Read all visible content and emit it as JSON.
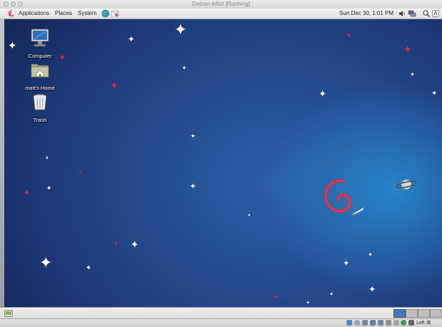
{
  "window": {
    "title": "Debian 64bit [Running]"
  },
  "top_panel": {
    "menus": [
      "Applications",
      "Places",
      "System"
    ],
    "clock": "Sun Dec 30,  1:01 PM"
  },
  "desktop": {
    "icons": [
      {
        "label": "Computer",
        "icon": "computer-icon"
      },
      {
        "label": "matt's Home",
        "icon": "home-folder-icon"
      },
      {
        "label": "Trash",
        "icon": "trash-icon"
      }
    ]
  },
  "vbox_status": {
    "host_key": "Left ⌘"
  },
  "colors": {
    "desktop_dark": "#16275a",
    "desktop_mid": "#2c5fa5",
    "glow": "#2896dc",
    "star_red": "#c8284a",
    "debian_swirl": "#d0304a",
    "active_workspace": "#4a76b6"
  }
}
